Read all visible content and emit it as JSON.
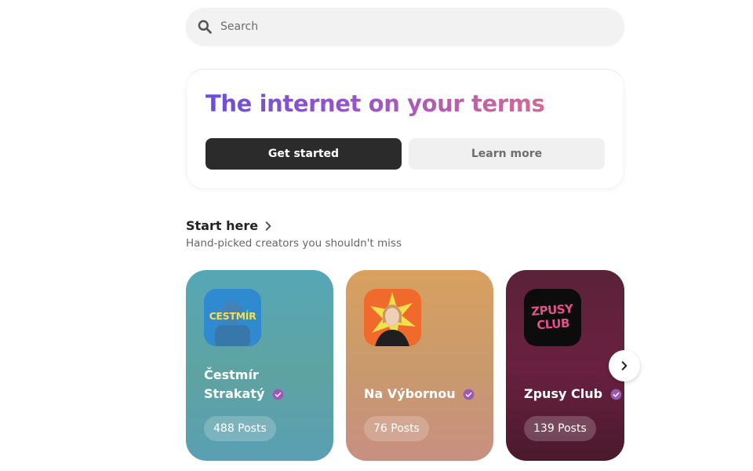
{
  "search": {
    "placeholder": "Search",
    "icon": "search-icon"
  },
  "hero": {
    "title": "The internet on your terms",
    "primary_label": "Get started",
    "secondary_label": "Learn more"
  },
  "section": {
    "title": "Start here",
    "subtitle": "Hand-picked creators you shouldn't miss"
  },
  "creators": [
    {
      "name_line1": "Čestmír",
      "name_line2": "Strakatý",
      "posts": "488 Posts",
      "avatar_text": "CESTMÍR"
    },
    {
      "name_line1": "",
      "name_line2": "Na Výbornou",
      "posts": "76 Posts",
      "avatar_text": ""
    },
    {
      "name_line1": "",
      "name_line2": "Zpusy Club",
      "posts": "139 Posts",
      "avatar_text": "ZPUSY CLUB"
    }
  ],
  "colors": {
    "accent_purple": "#6b4fd6",
    "accent_pink": "#d46a93",
    "verified": "#9b59b6",
    "primary_button": "#2b2b2b"
  }
}
